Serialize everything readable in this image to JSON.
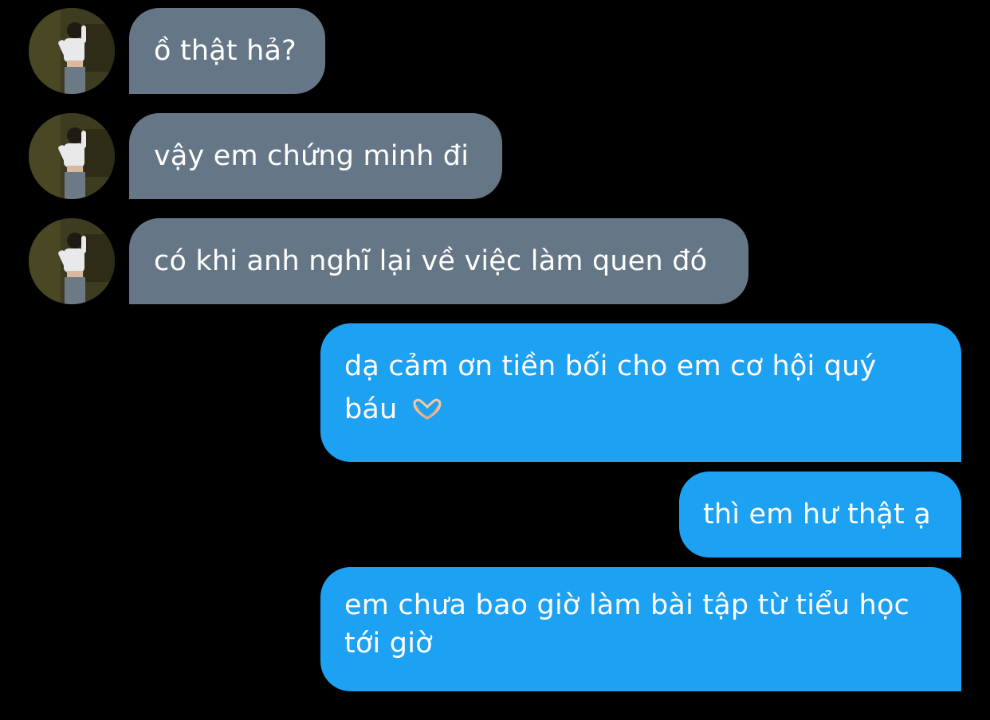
{
  "conversation": {
    "incoming": [
      {
        "text": "ồ thật hả?"
      },
      {
        "text": "vậy em chứng minh đi"
      },
      {
        "text": "có khi anh nghĩ lại về việc làm quen đó"
      }
    ],
    "outgoing": [
      {
        "line1": "dạ cảm ơn tiền bối cho em cơ hội quý",
        "line2": "báu",
        "emoji": "heart-hands-emoji"
      },
      {
        "text": "thì em hư thật ạ"
      },
      {
        "line1": "em chưa bao giờ làm bài tập từ tiểu học",
        "line2": "tới giờ"
      }
    ]
  },
  "colors": {
    "background": "#000000",
    "incoming_bubble": "#657786",
    "outgoing_bubble": "#1da1f2",
    "text": "#ffffff"
  },
  "icons": {
    "avatar": "contact-avatar-photo"
  }
}
